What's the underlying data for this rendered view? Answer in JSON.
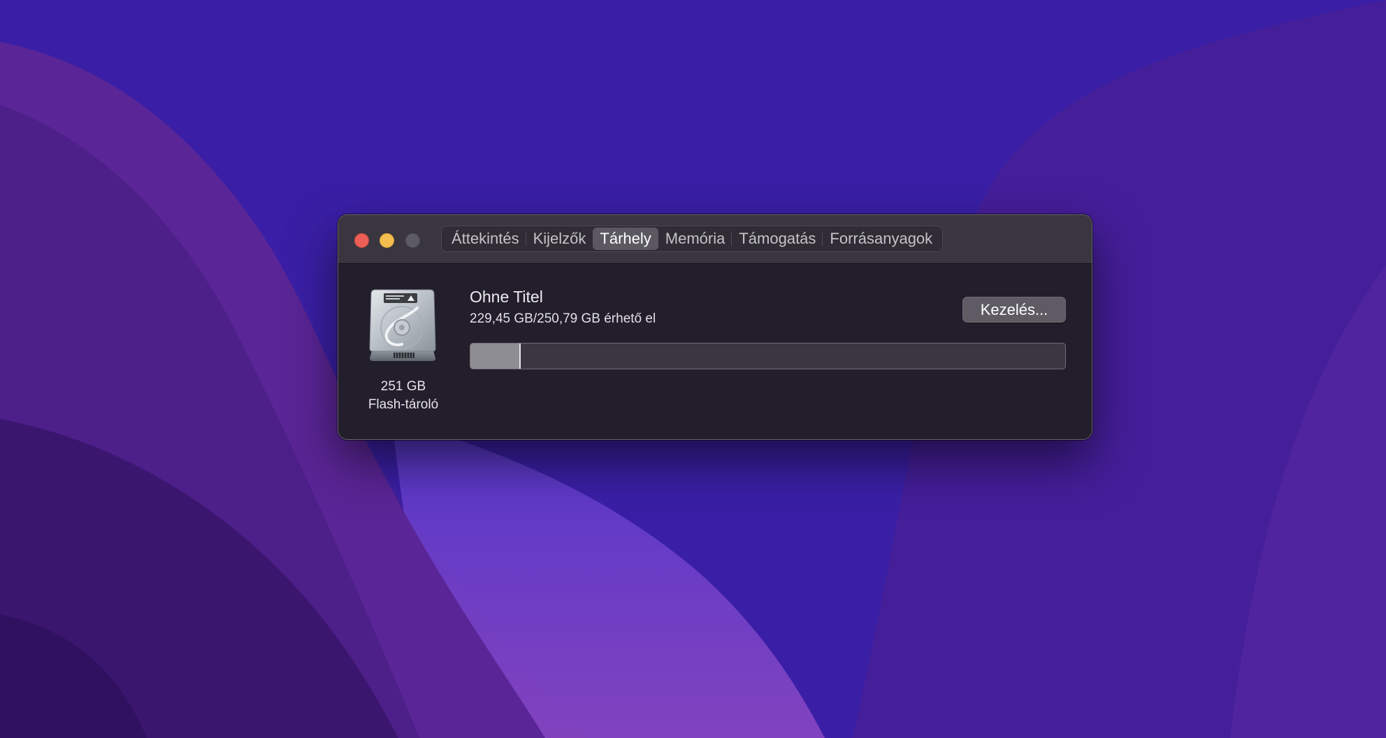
{
  "window": {
    "traffic_lights": [
      "close",
      "minimize",
      "zoom"
    ],
    "colors": {
      "close": "#ec5f56",
      "minimize": "#f3bd4f",
      "zoom": "#5c5a62"
    }
  },
  "tabs": [
    {
      "label": "Áttekintés",
      "active": false
    },
    {
      "label": "Kijelzők",
      "active": false
    },
    {
      "label": "Tárhely",
      "active": true
    },
    {
      "label": "Memória",
      "active": false
    },
    {
      "label": "Támogatás",
      "active": false
    },
    {
      "label": "Forrásanyagok",
      "active": false
    }
  ],
  "storage": {
    "disk_icon": "hard-drive-icon",
    "capacity": "251 GB",
    "type": "Flash-tároló",
    "volume_name": "Ohne Titel",
    "availability": "229,45 GB/250,79 GB érhető el",
    "manage_label": "Kezelés...",
    "used_fraction": 0.085
  }
}
